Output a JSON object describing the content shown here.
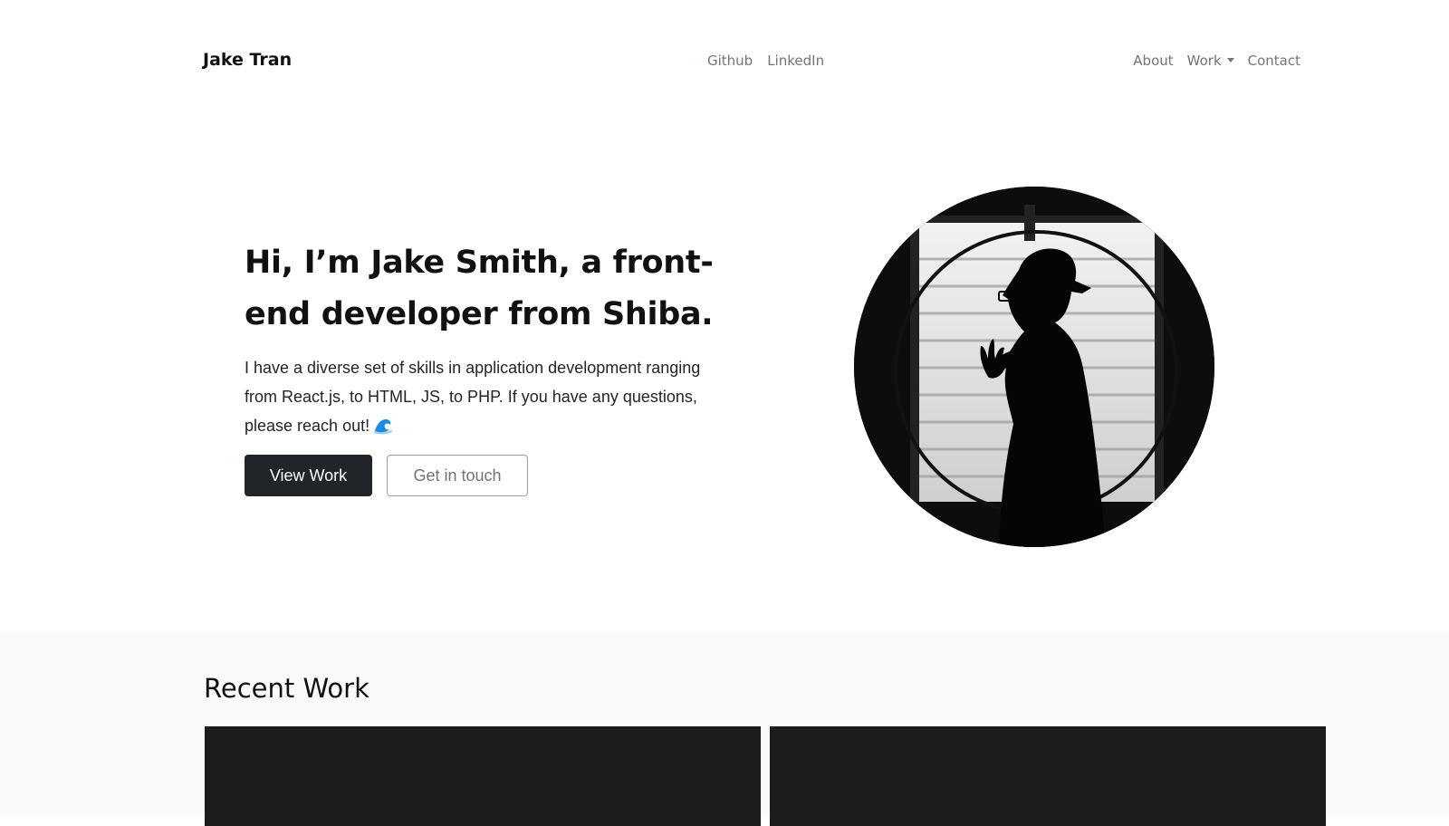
{
  "navbar": {
    "brand": "Jake Tran",
    "social_links": [
      "Github",
      "LinkedIn"
    ],
    "nav_links": {
      "about": "About",
      "work": "Work",
      "contact": "Contact"
    }
  },
  "hero": {
    "title": "Hi, I’m Jake Smith, a front-end developer from Shiba.",
    "lead": "I have a diverse set of skills in application development ranging from React.js, to HTML, JS, to PHP. If you have any questions, please reach out!",
    "lead_icon": "wave-icon",
    "buttons": {
      "primary": "View Work",
      "secondary": "Get in touch"
    },
    "portrait_icon": "portrait-silhouette"
  },
  "recent_work": {
    "title": "Recent Work"
  },
  "colors": {
    "dark": "#212529",
    "muted": "#6c757d",
    "section_bg": "#f8f9fa",
    "card_bg": "#1c1c1c"
  }
}
